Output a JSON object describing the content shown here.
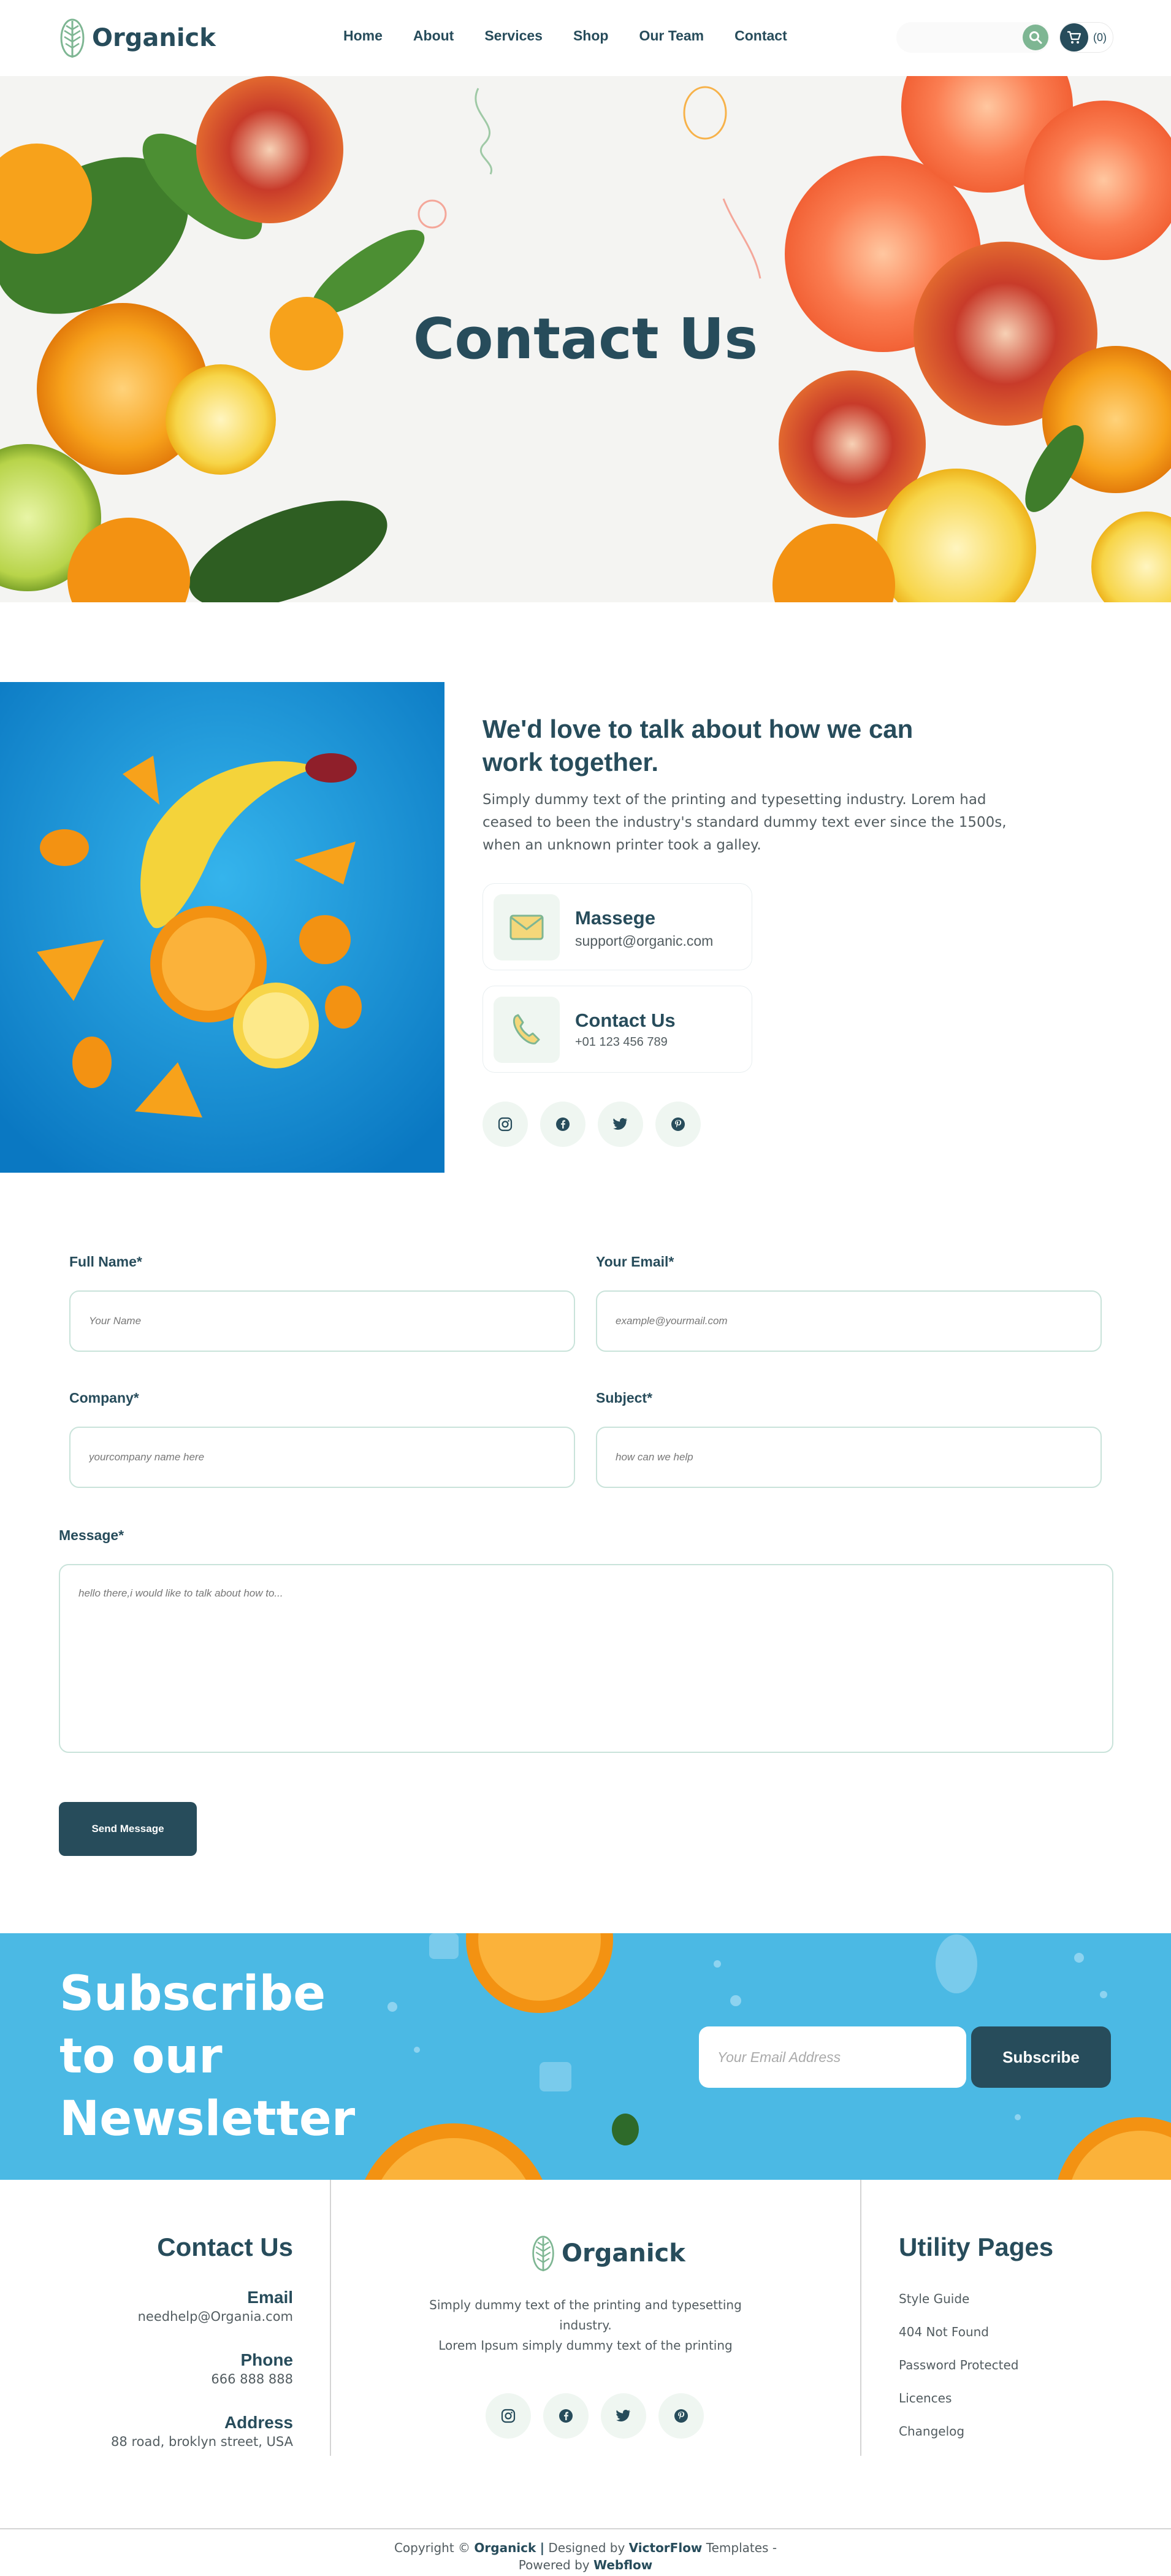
{
  "header": {
    "logo_text": "Organick",
    "nav": [
      "Home",
      "About",
      "Services",
      "Shop",
      "Our Team",
      "Contact"
    ],
    "cart_count": "(0)"
  },
  "hero": {
    "title": "Contact Us"
  },
  "talk": {
    "title": "We'd love to talk about how we can work together.",
    "description": "Simply dummy text of the printing and typesetting industry. Lorem had ceased to been the industry's standard dummy text ever since the 1500s, when an unknown printer took a galley.",
    "cards": [
      {
        "title": "Massege",
        "value": "support@organic.com",
        "icon": "envelope-icon"
      },
      {
        "title": "Contact Us",
        "value": "+01 123 456 789",
        "icon": "phone-icon"
      }
    ],
    "socials": [
      "instagram-icon",
      "facebook-icon",
      "twitter-icon",
      "pinterest-icon"
    ]
  },
  "form": {
    "full_name_label": "Full Name*",
    "full_name_placeholder": "Your Name",
    "email_label": "Your Email*",
    "email_placeholder": "example@yourmail.com",
    "company_label": "Company*",
    "company_placeholder": "yourcompany name here",
    "subject_label": "Subject*",
    "subject_placeholder": "how can we help",
    "message_label": "Message*",
    "message_placeholder": "hello there,i would like to talk about how to...",
    "send_label": "Send Message"
  },
  "newsletter": {
    "title": "Subscribe to our Newsletter",
    "input_placeholder": "Your Email Address",
    "button_label": "Subscribe"
  },
  "footer": {
    "contact_heading": "Contact Us",
    "email_label": "Email",
    "email_value": "needhelp@Organia.com",
    "phone_label": "Phone",
    "phone_value": "666 888 888",
    "address_label": "Address",
    "address_value": "88 road, broklyn street, USA",
    "logo_text": "Organick",
    "center_text_1": "Simply dummy text of the printing and typesetting industry.",
    "center_text_2": "Lorem Ipsum simply dummy text of the printing",
    "utility_heading": "Utility Pages",
    "utility_links": [
      "Style Guide",
      "404 Not Found",
      "Password Protected",
      "Licences",
      "Changelog"
    ],
    "copyright_prefix": "Copyright ©",
    "copyright_brand": "Organick",
    "copyright_sep": "|",
    "designed_by": "Designed by",
    "designer": "VictorFlow",
    "templates": "Templates -",
    "powered_by": "Powered by",
    "platform": "Webflow"
  },
  "colors": {
    "primary": "#274c5b",
    "accent": "#7eb693",
    "newsletter_bg": "#4bb9e4"
  }
}
